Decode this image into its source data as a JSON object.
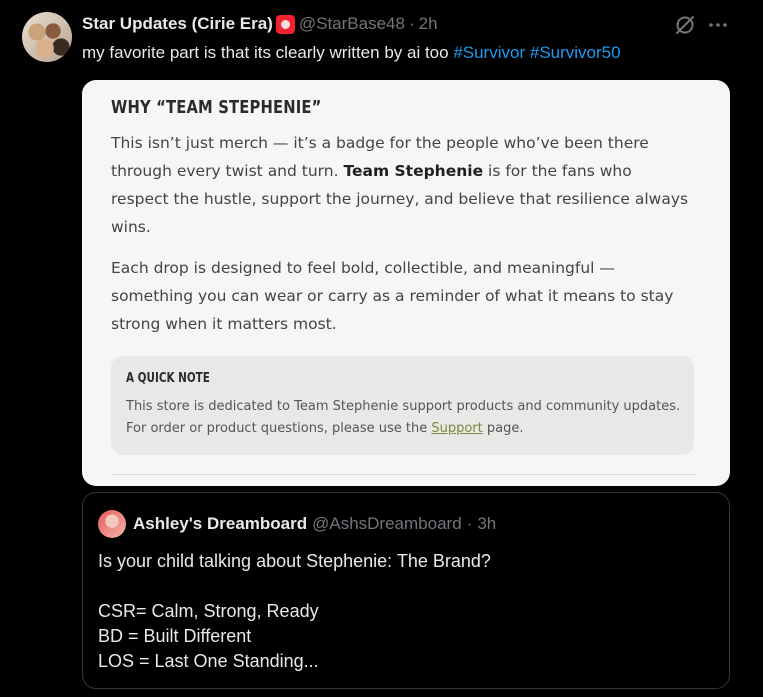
{
  "tweet": {
    "display_name": "Star Updates (Cirie Era)",
    "name_emoji": "siren-emoji",
    "handle": "@StarBase48",
    "separator": "·",
    "time": "2h",
    "text": "my favorite part is that its clearly written by ai too ",
    "hashtags": [
      "#Survivor",
      "#Survivor50"
    ]
  },
  "card": {
    "heading": "WHY “TEAM STEPHENIE”",
    "p1_before": "This isn’t just merch — it’s a badge for the people who’ve been there through every twist and turn. ",
    "p1_bold": "Team Stephenie",
    "p1_after": " is for the fans who respect the hustle, support the journey, and believe that resilience always wins.",
    "p2": "Each drop is designed to feel bold, collectible, and meaningful — something you can wear or carry as a reminder of what it means to stay strong when it matters most.",
    "note": {
      "heading": "A QUICK NOTE",
      "text_before": "This store is dedicated to Team Stephenie support products and community updates. For order or product questions, please use the ",
      "link": "Support",
      "text_after": " page."
    }
  },
  "quote": {
    "display_name": "Ashley's Dreamboard",
    "handle": "@AshsDreamboard",
    "separator": "·",
    "time": "3h",
    "lines": [
      "Is your child talking about Stephenie: The Brand?",
      "",
      "CSR= Calm, Strong, Ready",
      "BD = Built Different",
      "LOS = Last One Standing..."
    ]
  },
  "colors": {
    "accent": "#1d9bf0",
    "muted": "#71767b",
    "card_bg": "#f6f6f4",
    "link": "#7a8a3c"
  },
  "icons": [
    "grok-icon",
    "more-icon"
  ]
}
